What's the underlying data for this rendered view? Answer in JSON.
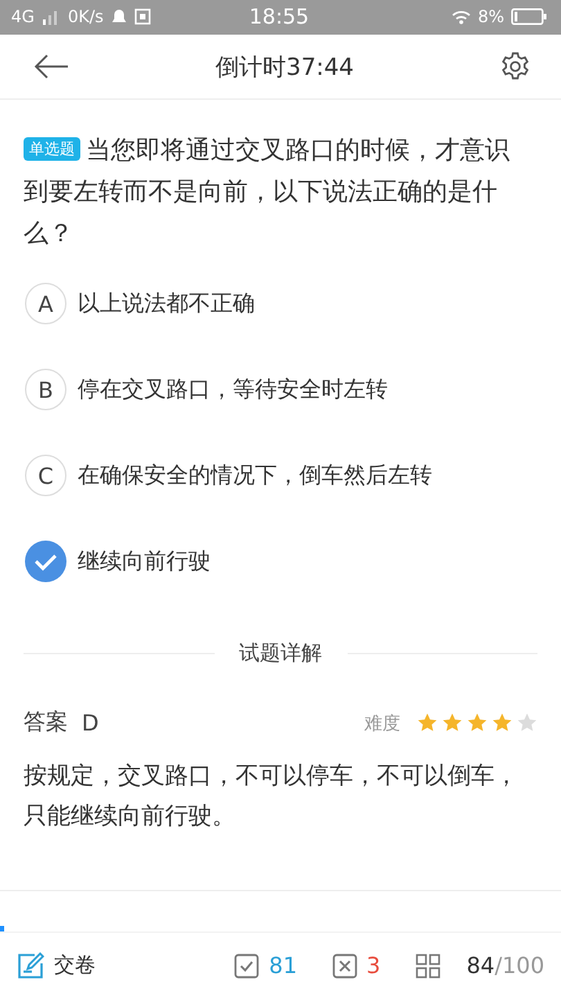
{
  "status_bar": {
    "network": "4G",
    "speed": "0K/s",
    "time": "18:55",
    "battery": "8%"
  },
  "header": {
    "title": "倒计时37:44"
  },
  "question": {
    "tag": "单选题",
    "text": "当您即将通过交叉路口的时候，才意识到要左转而不是向前，以下说法正确的是什么？"
  },
  "options": [
    {
      "letter": "A",
      "text": "以上说法都不正确",
      "selected": false
    },
    {
      "letter": "B",
      "text": "停在交叉路口，等待安全时左转",
      "selected": false
    },
    {
      "letter": "C",
      "text": "在确保安全的情况下，倒车然后左转",
      "selected": false
    },
    {
      "text": "继续向前行驶",
      "selected": true
    }
  ],
  "explanation": {
    "heading": "试题详解",
    "answer_label": "答案",
    "answer": "D",
    "difficulty_label": "难度",
    "stars": 4,
    "text": "按规定，交叉路口，不可以停车，不可以倒车，只能继续向前行驶。"
  },
  "bottom_bar": {
    "submit": "交卷",
    "correct": "81",
    "wrong": "3",
    "progress": "84",
    "total": "/100"
  }
}
